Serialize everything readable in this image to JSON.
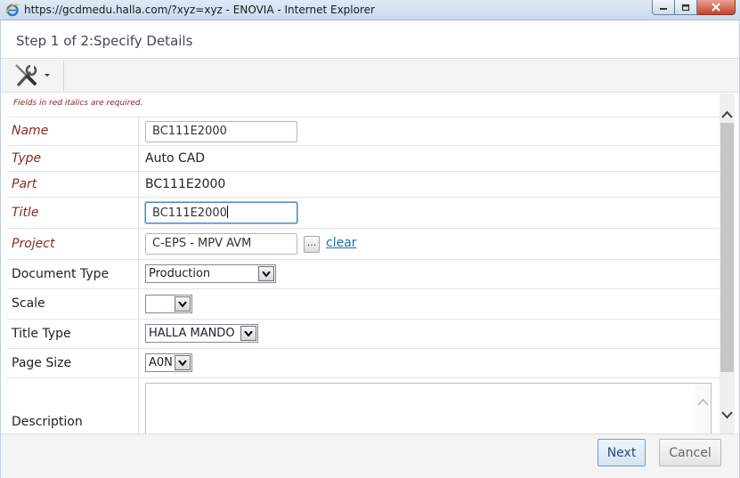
{
  "window": {
    "title": "https://gcdmedu.halla.com/?xyz=xyz - ENOVIA - Internet Explorer"
  },
  "page": {
    "title": "Step 1 of 2:Specify Details",
    "required_note": "Fields in red italics are required."
  },
  "toolbar": {
    "tools_icon": "tools-icon"
  },
  "fields": {
    "name": {
      "label": "Name",
      "value": "BC111E2000"
    },
    "type": {
      "label": "Type",
      "value": "Auto CAD"
    },
    "part": {
      "label": "Part",
      "value": "BC111E2000"
    },
    "title": {
      "label": "Title",
      "value": "BC111E2000"
    },
    "project": {
      "label": "Project",
      "value": "C-EPS - MPV AVM",
      "ellipsis": "...",
      "clear": "clear"
    },
    "document_type": {
      "label": "Document Type",
      "value": "Production"
    },
    "scale": {
      "label": "Scale",
      "value": ""
    },
    "title_type": {
      "label": "Title Type",
      "value": "HALLA MANDO"
    },
    "page_size": {
      "label": "Page Size",
      "value": "A0N"
    },
    "description": {
      "label": "Description",
      "value": ""
    }
  },
  "footer": {
    "next_label": "Next",
    "cancel_label": "Cancel"
  },
  "colors": {
    "required_label": "#8b2a1c",
    "link": "#1d6fb8",
    "focus_border": "#4f87c4"
  }
}
